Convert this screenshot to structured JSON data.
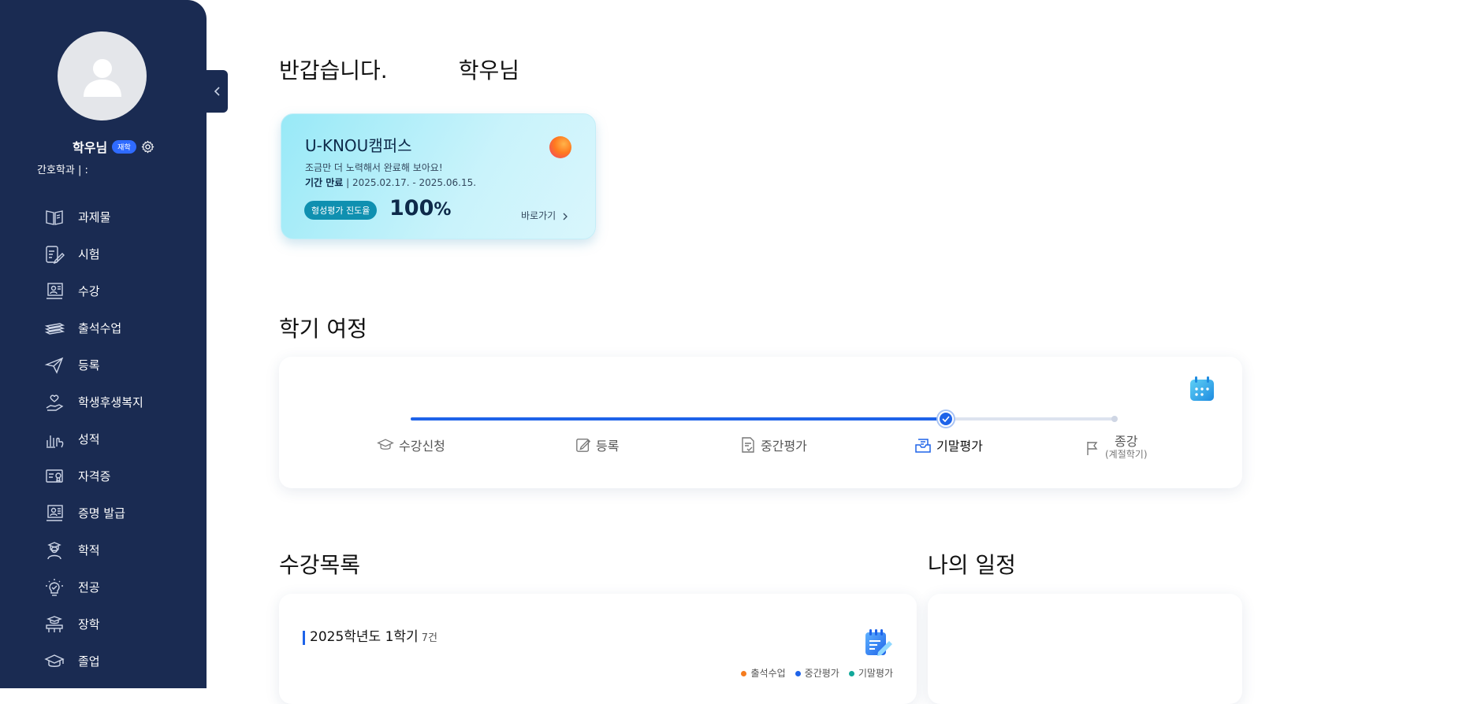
{
  "sidebar": {
    "user_name": "학우님",
    "status_badge": "재학",
    "department": "간호학과 | :",
    "items": [
      {
        "label": "과제물",
        "icon": "book-icon"
      },
      {
        "label": "시험",
        "icon": "exam-edit-icon"
      },
      {
        "label": "수강",
        "icon": "lecture-icon"
      },
      {
        "label": "출석수업",
        "icon": "books-stack-icon"
      },
      {
        "label": "등록",
        "icon": "paper-plane-icon"
      },
      {
        "label": "학생후생복지",
        "icon": "heart-hand-icon"
      },
      {
        "label": "성적",
        "icon": "chart-hand-icon"
      },
      {
        "label": "자격증",
        "icon": "certificate-icon"
      },
      {
        "label": "증명 발급",
        "icon": "document-issue-icon"
      },
      {
        "label": "학적",
        "icon": "student-icon"
      },
      {
        "label": "전공",
        "icon": "lightbulb-icon"
      },
      {
        "label": "장학",
        "icon": "scholarship-icon"
      },
      {
        "label": "졸업",
        "icon": "graduation-cap-icon"
      }
    ]
  },
  "header": {
    "greeting": "반갑습니다.",
    "user_suffix": "학우님"
  },
  "campus": {
    "title": "U-KNOU캠퍼스",
    "subtitle": "조금만 더 노력해서 완료해 보아요!",
    "period_label": "기간 만료",
    "period_value": "2025.02.17. - 2025.06.15.",
    "progress_label": "형성평가 진도율",
    "progress_value": "100",
    "progress_unit": "%",
    "go_label": "바로가기"
  },
  "journey": {
    "title": "학기 여정",
    "progress_fraction": 0.76,
    "steps": [
      {
        "label": "수강신청",
        "icon": "graduation-cap-icon"
      },
      {
        "label": "등록",
        "icon": "edit-icon"
      },
      {
        "label": "중간평가",
        "icon": "document-check-icon"
      },
      {
        "label": "기말평가",
        "icon": "mail-tray-icon"
      },
      {
        "label": "종강",
        "sub": "(계절학기)",
        "icon": "flag-icon"
      }
    ],
    "active_step": 3
  },
  "courses": {
    "title": "수강목록",
    "semester": "2025학년도 1학기",
    "count": "7건",
    "legend": [
      {
        "label": "출석수업",
        "color": "#f57c1f"
      },
      {
        "label": "중간평가",
        "color": "#1e63e9"
      },
      {
        "label": "기말평가",
        "color": "#12a89a"
      }
    ]
  },
  "schedule": {
    "title": "나의 일정"
  }
}
